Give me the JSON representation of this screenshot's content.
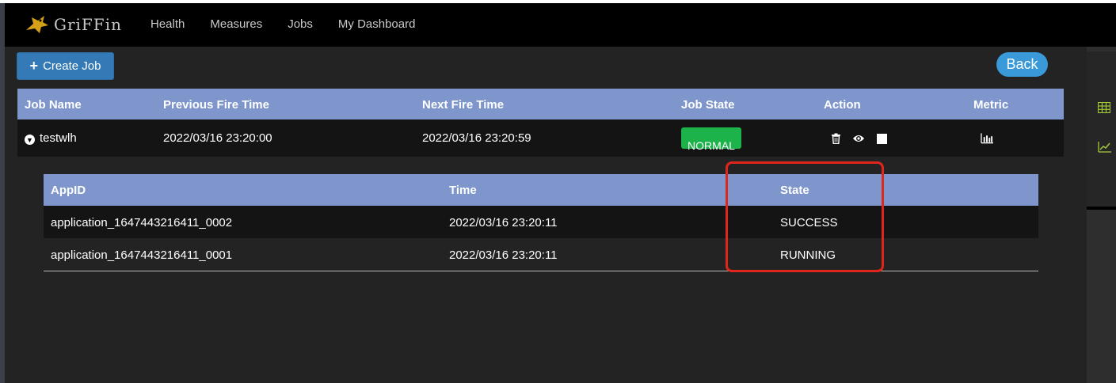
{
  "app": {
    "logo_text": "GriFFin"
  },
  "nav": {
    "items": [
      "Health",
      "Measures",
      "Jobs",
      "My Dashboard"
    ]
  },
  "toolbar": {
    "create_label": "Create Job",
    "back_label": "Back"
  },
  "jobs_table": {
    "headers": [
      "Job Name",
      "Previous Fire Time",
      "Next Fire Time",
      "Job State",
      "Action",
      "Metric"
    ],
    "rows": [
      {
        "name": "testwlh",
        "previous_fire_time": "2022/03/16 23:20:00",
        "next_fire_time": "2022/03/16 23:20:59",
        "state": "NORMAL",
        "actions": [
          "trash-icon",
          "eye-icon",
          "stop-icon"
        ],
        "metric_icon": "bar-chart-icon"
      }
    ]
  },
  "instances_table": {
    "headers": [
      "AppID",
      "Time",
      "State"
    ],
    "rows": [
      {
        "app_id": "application_1647443216411_0002",
        "time": "2022/03/16 23:20:11",
        "state": "SUCCESS"
      },
      {
        "app_id": "application_1647443216411_0001",
        "time": "2022/03/16 23:20:11",
        "state": "RUNNING"
      }
    ]
  },
  "side_panel": {
    "icons": [
      "table-icon",
      "line-chart-icon"
    ]
  },
  "colors": {
    "header_bg": "#7e96cc",
    "primary_button": "#337ab7",
    "back_button": "#3a9ad9",
    "normal_badge": "#1bb34a",
    "highlight_box": "#e0261c",
    "accent_icon": "#a4c639"
  }
}
